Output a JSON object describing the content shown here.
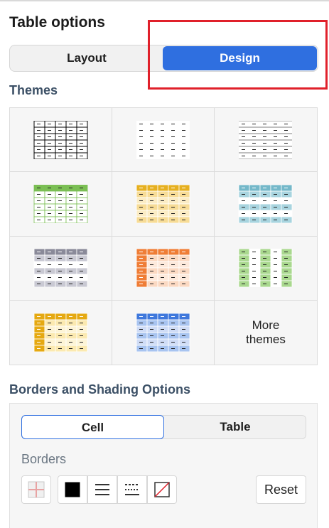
{
  "panel": {
    "title": "Table options",
    "tabs": [
      {
        "label": "Layout",
        "selected": false
      },
      {
        "label": "Design",
        "selected": true
      }
    ]
  },
  "themes": {
    "heading": "Themes",
    "items": [
      {
        "name": "grid-black",
        "style": "grid",
        "header": "#ffffff",
        "row1": "#ffffff",
        "row2": "#ffffff",
        "line": "#000000"
      },
      {
        "name": "plain",
        "style": "plain",
        "header": "#ffffff",
        "row1": "#ffffff",
        "row2": "#ffffff",
        "line": "#ffffff"
      },
      {
        "name": "horizontal-lines",
        "style": "hlines",
        "header": "#ffffff",
        "row1": "#ffffff",
        "row2": "#ffffff",
        "line": "#555555"
      },
      {
        "name": "green",
        "style": "headed",
        "header": "#7bbf54",
        "row1": "#ffffff",
        "row2": "#ffffff",
        "line": "#7bbf54"
      },
      {
        "name": "gold",
        "style": "banded",
        "header": "#e6b020",
        "row1": "#f7dc96",
        "row2": "#fbecc4",
        "line": "#ffffff"
      },
      {
        "name": "teal",
        "style": "banded",
        "header": "#74b8c9",
        "row1": "#a8d4df",
        "row2": "#ffffff",
        "line": "#ffffff"
      },
      {
        "name": "gray",
        "style": "banded",
        "header": "#8a8a99",
        "row1": "#c9c9d3",
        "row2": "#ffffff",
        "line": "#ffffff"
      },
      {
        "name": "orange",
        "style": "firstcol",
        "header": "#ef7d36",
        "row1": "#fbd9c2",
        "row2": "#fde9db",
        "line": "#ffffff"
      },
      {
        "name": "light-green",
        "style": "columns",
        "header": "#a9d88e",
        "row1": "#a9d88e",
        "row2": "#ffffff",
        "line": "#ffffff"
      },
      {
        "name": "yellow",
        "style": "firstcol",
        "header": "#e5a912",
        "row1": "#fbe9b0",
        "row2": "#fdf4d6",
        "line": "#ffffff"
      },
      {
        "name": "blue",
        "style": "banded",
        "header": "#3f78dc",
        "row1": "#a8c4f0",
        "row2": "#cfdcf6",
        "line": "#ffffff"
      }
    ],
    "more_label_1": "More",
    "more_label_2": "themes"
  },
  "borders_section": {
    "heading": "Borders and Shading Options",
    "tabs": [
      {
        "label": "Cell",
        "selected": true
      },
      {
        "label": "Table",
        "selected": false
      }
    ],
    "borders_label": "Borders",
    "reset_label": "Reset",
    "icons": [
      "border-preview-icon",
      "border-color-icon",
      "border-style-solid-icon",
      "border-style-dashed-icon",
      "no-border-icon"
    ]
  },
  "highlight_color": "#e0202a",
  "accent_color": "#2f6fe0"
}
